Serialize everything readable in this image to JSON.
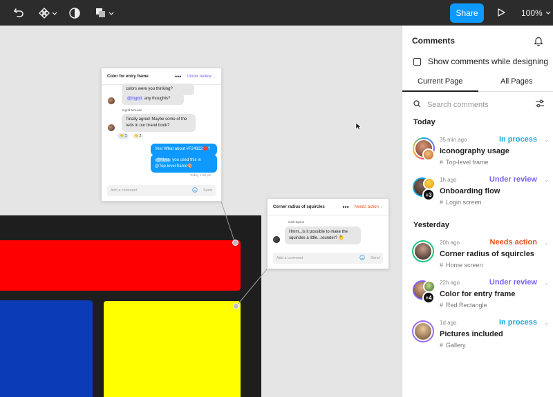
{
  "toolbar": {
    "share_label": "Share",
    "zoom_label": "100%"
  },
  "canvas": {
    "cards": [
      {
        "title": "Color for entry frame",
        "status": "Under review",
        "status_color": "#7b61ff",
        "messages": {
          "m1_text": "colors were you thinking?",
          "m2_mention": "@Ingrid",
          "m2_text": " any thoughts?",
          "author2": "Ingrid McLean",
          "m3_text": "Totally agree! Maybe some of the reds in our brand book?",
          "reaction1": "👏 1",
          "reaction2": "👋 2",
          "m4_text": "Yes! What about #F24822🔴?",
          "m5_mention": "@Myra",
          "m5_text": " you used this in @Top-level frame🎨",
          "timestamp": "Today, 1:50 pm"
        },
        "input_placeholder": "Add a comment",
        "send_label": "Send"
      },
      {
        "title": "Corner radius of squircles",
        "status": "Needs action",
        "status_color": "#e8501f",
        "author": "Carli Epson",
        "message": "Hmm...is it possible to make the squircles a little...rounder? 🤔",
        "input_placeholder": "Add a comment",
        "send_label": "Send"
      }
    ],
    "colors": {
      "red": "#ff0000",
      "blue": "#0c3bb8",
      "yellow": "#ffff00",
      "frame": "#1e1e1e"
    }
  },
  "sidebar": {
    "title": "Comments",
    "show_comments_label": "Show comments while designing",
    "tabs": [
      "Current Page",
      "All Pages"
    ],
    "search_placeholder": "Search comments",
    "sections": [
      {
        "heading": "Today",
        "items": [
          {
            "time": "35 min ago",
            "status": "In process",
            "status_color": "#14a9db",
            "title": "Iconography usage",
            "frame": "Top-level frame",
            "badge": ""
          },
          {
            "time": "1h ago",
            "status": "Under review",
            "status_color": "#7b61ff",
            "title": "Onboarding flow",
            "frame": "Login screen",
            "badge": "+3"
          }
        ]
      },
      {
        "heading": "Yesterday",
        "items": [
          {
            "time": "20h ago",
            "status": "Needs action",
            "status_color": "#e8501f",
            "title": "Corner radius of squircles",
            "frame": "Home screen",
            "badge": ""
          },
          {
            "time": "22h ago",
            "status": "Under review",
            "status_color": "#7b61ff",
            "title": "Color for entry frame",
            "frame": "Red Rectangle",
            "badge": "+4"
          },
          {
            "time": "1d ago",
            "status": "In process",
            "status_color": "#14a9db",
            "title": "Pictures included",
            "frame": "Gallery",
            "badge": ""
          }
        ]
      }
    ]
  },
  "icons": [
    "move-tool-icon",
    "components-icon",
    "contrast-icon",
    "shapes-icon",
    "play-icon",
    "bell-icon",
    "search-icon",
    "filter-icon",
    "hash-icon",
    "cursor-icon"
  ]
}
